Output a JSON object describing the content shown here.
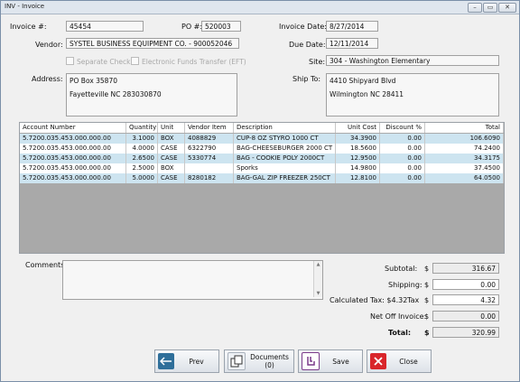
{
  "window": {
    "title": "INV - Invoice",
    "min": "–",
    "max": "▭",
    "close": "✕"
  },
  "header": {
    "invoice_label": "Invoice #:",
    "invoice_no": "45454",
    "po_label": "PO #:",
    "po_no": "520003",
    "invoice_date_label": "Invoice Date:",
    "invoice_date": "8/27/2014",
    "vendor_label": "Vendor:",
    "vendor": "SYSTEL BUSINESS EQUIPMENT CO. - 900052046",
    "due_date_label": "Due Date:",
    "due_date": "12/11/2014",
    "separate_check": "Separate Check",
    "eft": "Electronic Funds Transfer (EFT)",
    "site_label": "Site:",
    "site": "304 - Washington Elementary",
    "address_label": "Address:",
    "address_line1": "PO Box 35870",
    "address_line2": "Fayetteville NC 283030870",
    "ship_to_label": "Ship To:",
    "ship_line1": "4410 Shipyard Blvd",
    "ship_line2": "Wilmington NC 28411"
  },
  "grid": {
    "columns": [
      "Account Number",
      "Quantity",
      "Unit",
      "Vendor Item",
      "Description",
      "Unit Cost",
      "Discount %",
      "Total"
    ],
    "rows": [
      [
        "5.7200.035.453.000.000.00",
        "3.1000",
        "BOX",
        "4088829",
        "CUP-8 OZ STYRO  1000 CT",
        "34.3900",
        "0.00",
        "106.6090"
      ],
      [
        "5.7200.035.453.000.000.00",
        "4.0000",
        "CASE",
        "6322790",
        "BAG-CHEESEBURGER 2000 CT",
        "18.5600",
        "0.00",
        "74.2400"
      ],
      [
        "5.7200.035.453.000.000.00",
        "2.6500",
        "CASE",
        "5330774",
        "BAG - COOKIE POLY 2000CT",
        "12.9500",
        "0.00",
        "34.3175"
      ],
      [
        "5.7200.035.453.000.000.00",
        "2.5000",
        "BOX",
        "",
        "Sporks",
        "14.9800",
        "0.00",
        "37.4500"
      ],
      [
        "5.7200.035.453.000.000.00",
        "5.0000",
        "CASE",
        "8280182",
        "BAG-GAL ZIP FREEZER 250CT",
        "12.8100",
        "0.00",
        "64.0500"
      ]
    ]
  },
  "comments_label": "Comments:",
  "totals": {
    "subtotal_label": "Subtotal:",
    "subtotal": "316.67",
    "shipping_label": "Shipping:",
    "shipping": "0.00",
    "calc_tax_label": "Calculated Tax: $4.32",
    "tax_label": "Tax",
    "tax": "4.32",
    "net_off_label": "Net Off Invoice:",
    "net_off": "0.00",
    "total_label": "Total:",
    "total": "320.99",
    "currency": "$"
  },
  "buttons": {
    "prev": "Prev",
    "documents": "Documents (0)",
    "save": "Save",
    "close": "Close"
  },
  "colors": {
    "row_highlight": "#cde4f0",
    "prev_icon": "#2f6f9a",
    "save_icon": "#7a3a8a",
    "close_icon": "#d9262b"
  }
}
